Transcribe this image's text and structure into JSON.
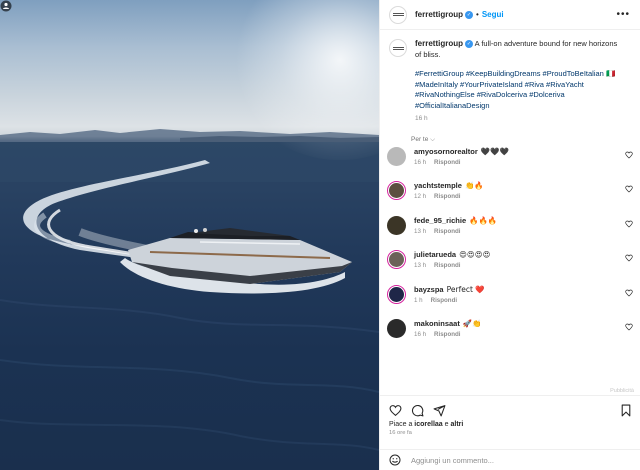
{
  "post": {
    "author": "ferrettigroup",
    "follow_label": "Segui",
    "dot": "•",
    "more_label": "•••"
  },
  "caption": {
    "text": "A full-on adventure bound for new horizons of bliss.",
    "hashtags": "#FerrettiGroup #KeepBuildingDreams #ProudToBeItalian 🇮🇹 #MadeInItaly #YourPrivateIsland #Riva #RivaYacht #RivaNothingElse #RivaDolceriva #Dolceriva #OfficialItalianaDesign",
    "time": "16 h"
  },
  "translation_label": "Per te ⌵",
  "comments": [
    {
      "user": "amyosornorealtor",
      "text": "🖤🖤🖤",
      "time": "16 h",
      "reply": "Rispondi",
      "avatar_color": "#b9b9b9",
      "story": false
    },
    {
      "user": "yachtstemple",
      "text": "👏🔥",
      "time": "12 h",
      "reply": "Rispondi",
      "avatar_color": "#5b4e3f",
      "story": true
    },
    {
      "user": "fede_95_richie",
      "text": "🔥🔥🔥",
      "time": "13 h",
      "reply": "Rispondi",
      "avatar_color": "#3b3526",
      "story": false
    },
    {
      "user": "julietarueda",
      "text": "😍😍😍😍",
      "time": "13 h",
      "reply": "Rispondi",
      "avatar_color": "#6b6158",
      "story": true
    },
    {
      "user": "bayzspa",
      "text": "Perfect ❤️",
      "time": "1 h",
      "reply": "Rispondi",
      "avatar_color": "#1f2648",
      "story": true
    },
    {
      "user": "makoninsaat",
      "text": "🚀👏",
      "time": "16 h",
      "reply": "Rispondi",
      "avatar_color": "#2a2a2a",
      "story": false
    }
  ],
  "watermark": "Pubblicità",
  "likes": {
    "prefix": "Piace a ",
    "user": "icorellaa",
    "suffix": " e ",
    "others": "altri"
  },
  "posted_ago": "16 ore fa",
  "add_comment": {
    "placeholder": "Aggiungi un commento..."
  },
  "colors": {
    "accent": "#0095f6",
    "hashtag": "#00376b",
    "story_ring": "#d6249f"
  },
  "icons": [
    "heart-icon",
    "comment-icon",
    "share-icon",
    "bookmark-icon",
    "emoji-icon",
    "verified-icon",
    "more-icon",
    "media-indicator-icon"
  ]
}
